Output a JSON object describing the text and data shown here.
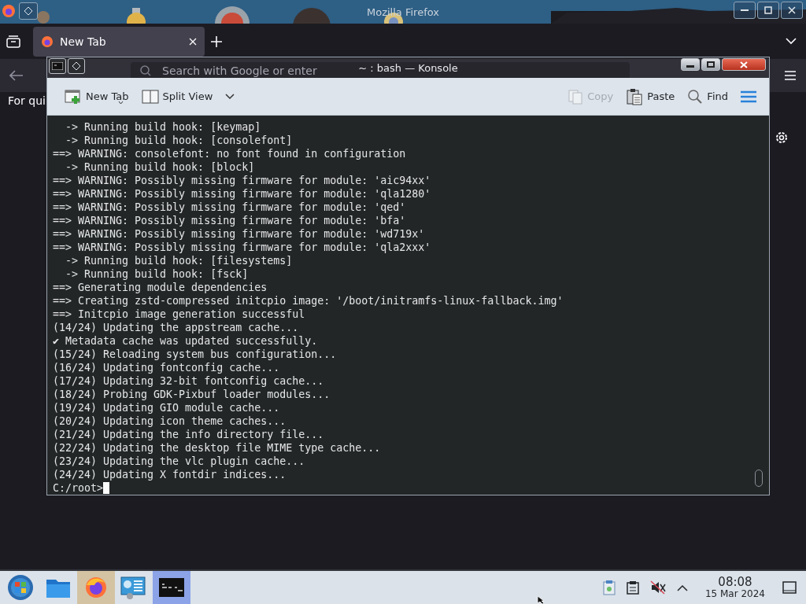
{
  "firefox": {
    "title": "Mozilla Firefox",
    "tabs": [
      {
        "label": "New Tab",
        "selected": true
      }
    ],
    "search": {
      "placeholder": "Search with Google or enter"
    },
    "page_text": "For qui"
  },
  "konsole": {
    "title": "~ : bash — Konsole",
    "toolbar_left": [
      {
        "kind": "new-tab",
        "label": "New Tab",
        "disabled": false
      },
      {
        "kind": "split-view",
        "label": "Split View",
        "disabled": false
      }
    ],
    "toolbar_right": [
      {
        "kind": "copy",
        "label": "Copy",
        "disabled": true
      },
      {
        "kind": "paste",
        "label": "Paste",
        "disabled": false
      },
      {
        "kind": "find",
        "label": "Find",
        "disabled": false
      }
    ],
    "lines": [
      "  -> Running build hook: [keymap]",
      "  -> Running build hook: [consolefont]",
      "==> WARNING: consolefont: no font found in configuration",
      "  -> Running build hook: [block]",
      "==> WARNING: Possibly missing firmware for module: 'aic94xx'",
      "==> WARNING: Possibly missing firmware for module: 'qla1280'",
      "==> WARNING: Possibly missing firmware for module: 'qed'",
      "==> WARNING: Possibly missing firmware for module: 'bfa'",
      "==> WARNING: Possibly missing firmware for module: 'wd719x'",
      "==> WARNING: Possibly missing firmware for module: 'qla2xxx'",
      "  -> Running build hook: [filesystems]",
      "  -> Running build hook: [fsck]",
      "==> Generating module dependencies",
      "==> Creating zstd-compressed initcpio image: '/boot/initramfs-linux-fallback.img'",
      "==> Initcpio image generation successful",
      "(14/24) Updating the appstream cache...",
      "✔ Metadata cache was updated successfully.",
      "(15/24) Reloading system bus configuration...",
      "(16/24) Updating fontconfig cache...",
      "(17/24) Updating 32-bit fontconfig cache...",
      "(18/24) Probing GDK-Pixbuf loader modules...",
      "(19/24) Updating GIO module cache...",
      "(20/24) Updating icon theme caches...",
      "(21/24) Updating the info directory file...",
      "(22/24) Updating the desktop file MIME type cache...",
      "(23/24) Updating the vlc plugin cache...",
      "(24/24) Updating X fontdir indices..."
    ],
    "prompt": "C:/root>"
  },
  "taskbar": {
    "apps": [
      {
        "kind": "start",
        "running": false,
        "focused": false
      },
      {
        "kind": "files",
        "running": false,
        "focused": false
      },
      {
        "kind": "firefox",
        "running": true,
        "focused": false
      },
      {
        "kind": "settings",
        "running": false,
        "focused": false
      },
      {
        "kind": "terminal",
        "running": true,
        "focused": true
      }
    ],
    "time": "08:08",
    "date": "15 Mar 2024"
  }
}
